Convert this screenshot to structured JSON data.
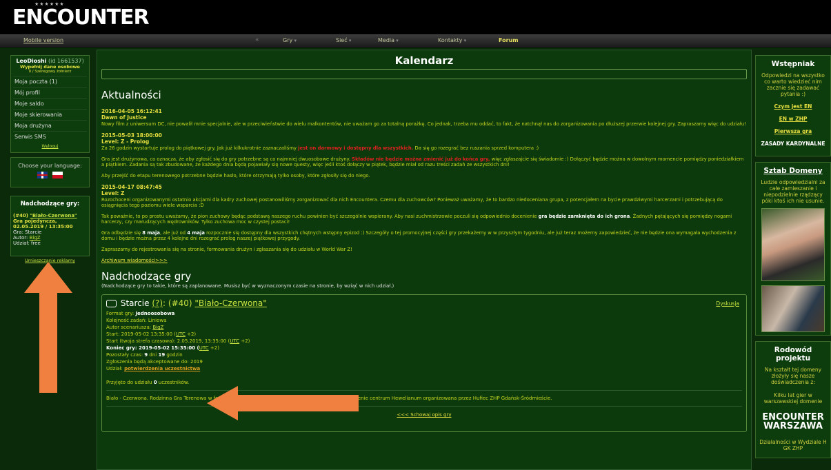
{
  "header": {
    "logo_text": "ENCOUNTER",
    "logo_stars": "★★★★★★",
    "mobile_version": "Mobile version",
    "nav": [
      {
        "label": "Gry"
      },
      {
        "label": "Sieć"
      },
      {
        "label": "Media"
      },
      {
        "label": "Kontakty"
      },
      {
        "label": "Forum"
      }
    ],
    "nav_separator": "«"
  },
  "user": {
    "name": "LeoDioshi",
    "id": "(id 1661537)",
    "fill_data": "Wypełnij dane osobowe",
    "sub": "0 / Szeregowy żołnierz",
    "menu": [
      {
        "label": "Moja poczta (1)"
      },
      {
        "label": "Mój profil"
      },
      {
        "label": "Moje saldo"
      },
      {
        "label": "Moje skierowania"
      },
      {
        "label": "Moja drużyna"
      },
      {
        "label": "Serwis SMS"
      }
    ],
    "logout": "Wyloguj"
  },
  "language": {
    "title": "Choose your language:"
  },
  "upcoming_sidebar": {
    "title": "Nadchodzące gry:",
    "game_num": "(#40)",
    "game_name": "\"Biało-Czerwona\"",
    "type": "Gra pojedyncza,",
    "datetime": "02.05.2019 / 13:35:00",
    "game_line": "Gra: Starcie",
    "author_label": "Autor:",
    "author": "BigZ",
    "fee": "Udział: free",
    "ads": "Umieszczanie reklamy"
  },
  "main": {
    "title": "Kalendarz",
    "news_heading": "Aktualności",
    "news": [
      {
        "date": "2016-04-05 16:12:41",
        "title": "Dawn of Justice",
        "paragraphs": [
          "Nowy film z uniwersum DC, nie powalił mnie specjalnie, ale w przeciwieństwie do wielu malkontentów, nie uważam go za totalną porażkę. Co jednak, trzeba mu oddać, to fakt, że natchnął nas do zorganizowania po dłuższej przerwie kolejnej gry. Zapraszamy więc do udziału!"
        ]
      },
      {
        "date": "2015-05-03 18:00:00",
        "title": "Level: Z - Prolog",
        "p1_a": "Za 26 godzin wystartuje prolog do piątkowej gry. Jak już kilkukrotnie zaznaczaliśmy ",
        "p1_red": "jest on darmowy i dostępny dla wszystkich.",
        "p1_b": " Da się go rozegrać bez ruszania sprzed komputera :)",
        "p2_a": "Gra jest drużynowa, co oznacza, że aby zgłosić się do gry potrzebne są co najmniej dwuosobowe drużyny. ",
        "p2_red": "Składów nie będzie można zmienić już do końca gry,",
        "p2_b": " więc zgłaszajcie się świadomie :) Dołączyć będzie można w dowolnym momencie pomiędzy poniedziałkiem a piątkiem. Zadania są tak zbudowane, że każdego dnia będą pojawiały się nowe questy, więc jeśli ktoś dołączy w piątek, będzie miał od razu treści zadań ze wszystkich dni!",
        "p3": "Aby przejść do etapu terenowego potrzebne będzie hasło, które otrzymają tylko osoby, które zgłosiły się do niego."
      },
      {
        "date": "2015-04-17 08:47:45",
        "title": "Level: Z",
        "p1": "Rozochoceni organizowanymi ostatnio akcjami dla kadry zuchowej postanowiliśmy zorganizować dla nich Encountera. Czemu dla zuchowców? Ponieważ uważamy, że to bardzo niedoceniana grupa, z potencjałem na bycie prawdziwymi harcerzami i potrzebującą do osiągnięcia tego poziomu wiele wsparcia :D",
        "p2_a": "Tak poważnie, to po prostu uważamy, że pion zuchowy będąc podstawą naszego ruchu powinien być szczególnie wspierany. Aby nasi zuchmistrzowie poczuli się odpowiednio docenienie ",
        "p2_b": "gra będzie zamknięta do ich grona",
        "p2_c": ". Żadnych pętających się pomiędzy nogami harcerzy, czy marudzących wędrowników. Tylko zuchowa moc w czystej postaci!",
        "p3_a": "Gra odbędzie się ",
        "p3_b": "8 maja",
        "p3_c": ", ale już od ",
        "p3_d": "4 maja",
        "p3_e": " rozpocznie się dostępny dla wszystkich chętnych wstępny epizod :) Szczegóły o tej promocyjnej części gry przekażemy w w przyszłym tygodniu, ale już teraz możemy zapowiedzieć, że nie będzie ona wymagała wychodzenia z domu i będzie można przez 4 kolejne dni rozegrać prolog naszej piątkowej przygody.",
        "p4": "Zapraszamy do rejestrowania się na stronie, formowania drużyn i zgłaszania się do udziału w World War Z!"
      }
    ],
    "archive": "Archiwum wiadomości>>>",
    "upcoming_heading": "Nadchodzące gry",
    "upcoming_sub": "(Nadchodzące gry to takie, które są zaplanowane. Musisz być w wyznaczonym czasie na stronie, by wziąć w nich udział.)",
    "game": {
      "head_a": "Starcie ",
      "head_q": "(?)",
      "head_b": ": (#40) ",
      "head_name": "\"Biało-Czerwona\"",
      "discussion": "Dyskusja",
      "format_label": "Format gry: ",
      "format": "Jednoosobowa",
      "order": "Kolejność zadań: Liniowa",
      "author_label": "Autor scenariusza: ",
      "author": "BigZ",
      "start_a": "Start: 2019-05-02 13:35:00 (",
      "utc": "UTC",
      "start_b": " +2)",
      "start_local_a": "Start (twoja strefa czasowa): 2.05.2019, 13:35:00 (",
      "end_a": "Koniec gry: 2019-05-02 15:35:00 (",
      "left_a": "Pozostały czas: ",
      "left_d": "9",
      "left_b": " dni ",
      "left_h": "19",
      "left_c": " godzin",
      "apps": "Zgłoszenia będą akceptowane do: 2019",
      "part_label": "Udział: ",
      "part_link": "potwierdzenia uczestnictwa",
      "accepted_a": "Przyjęto do udziału ",
      "accepted_n": "0",
      "accepted_b": " uczestników.",
      "description": "Biało - Czerwona. Rodzinna Gra Terenowa w formie Encountera z okazji Dnia Flagi odbywająca się na terenie centrum Hewelianum organizowana przez Hufiec ZHP Gdańsk-Śródmieście.",
      "hide": "<<< Schowaj opis gry"
    }
  },
  "right": {
    "box1_title": "Wstępniak",
    "box1_text": "Odpowiedzi na wszystko co warto wiedzieć nim zacznie się zadawać pytania :)",
    "links": [
      {
        "label": "Czym jest EN"
      },
      {
        "label": "EN w ZHP"
      },
      {
        "label": "Pierwsza gra"
      },
      {
        "label": "ZASADY KARDYNALNE"
      }
    ],
    "box2_title": "Sztab Domeny",
    "box2_text": "Ludzie odpowiedzialni za całe zamieszanie i niepodzielnie rządzący póki ktoś ich nie usunie.",
    "box3_title": "Rodowód projektu",
    "box3_text": "Na kształt tej domeny złożyły się nasze doświadczenia z:",
    "box3_text2": "Kilku lat gier w warszawskiej domenie",
    "enc_logo_1": "ENCOUNTER",
    "enc_logo_2": "WARSZAWA",
    "box3_footer": "Działalności w Wydziale H GK ZHP"
  },
  "colors": {
    "background": "#0a2a0a",
    "panel": "#0c3a0c",
    "accent_yellow": "#e8e040",
    "link_green": "#c8e040",
    "warning_red": "#e02020",
    "arrow_orange": "#f08040"
  }
}
